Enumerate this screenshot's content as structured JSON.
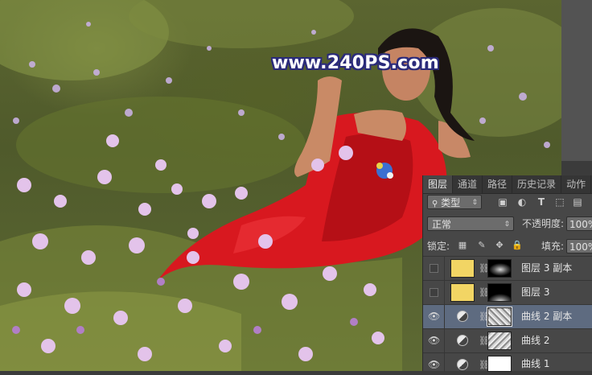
{
  "watermark": "www.240PS.com",
  "panel": {
    "tabs": [
      "图层",
      "通道",
      "路径",
      "历史记录",
      "动作"
    ],
    "filter_kind": "类型",
    "blend_mode": "正常",
    "opacity_label": "不透明度:",
    "opacity_value": "100%",
    "lock_label": "锁定:",
    "fill_label": "填充:",
    "fill_value": "100%",
    "layers": [
      {
        "name": "图层 3 副本",
        "visible": false,
        "selected": false,
        "type": "pixel",
        "color": "#f2d564",
        "mask": "dark-top-glow"
      },
      {
        "name": "图层 3",
        "visible": false,
        "selected": false,
        "type": "pixel",
        "color": "#f2d564",
        "mask": "dark-bottom-glow"
      },
      {
        "name": "曲线 2 副本",
        "visible": true,
        "selected": true,
        "type": "curves",
        "mask": "texture"
      },
      {
        "name": "曲线 2",
        "visible": true,
        "selected": false,
        "type": "curves",
        "mask": "texture"
      },
      {
        "name": "曲线 1",
        "visible": true,
        "selected": false,
        "type": "curves",
        "mask": "white"
      }
    ]
  },
  "icons": {
    "filter": "search-icon",
    "image_filter": "image-filter-icon",
    "adjust_filter": "adjustment-filter-icon",
    "text_filter": "text-filter-icon",
    "shape_filter": "shape-filter-icon",
    "smart_filter": "smart-object-filter-icon",
    "lock_pixels": "lock-transparent-icon",
    "lock_brush": "brush-lock-icon",
    "lock_move": "move-lock-icon",
    "lock_all": "lock-icon"
  }
}
